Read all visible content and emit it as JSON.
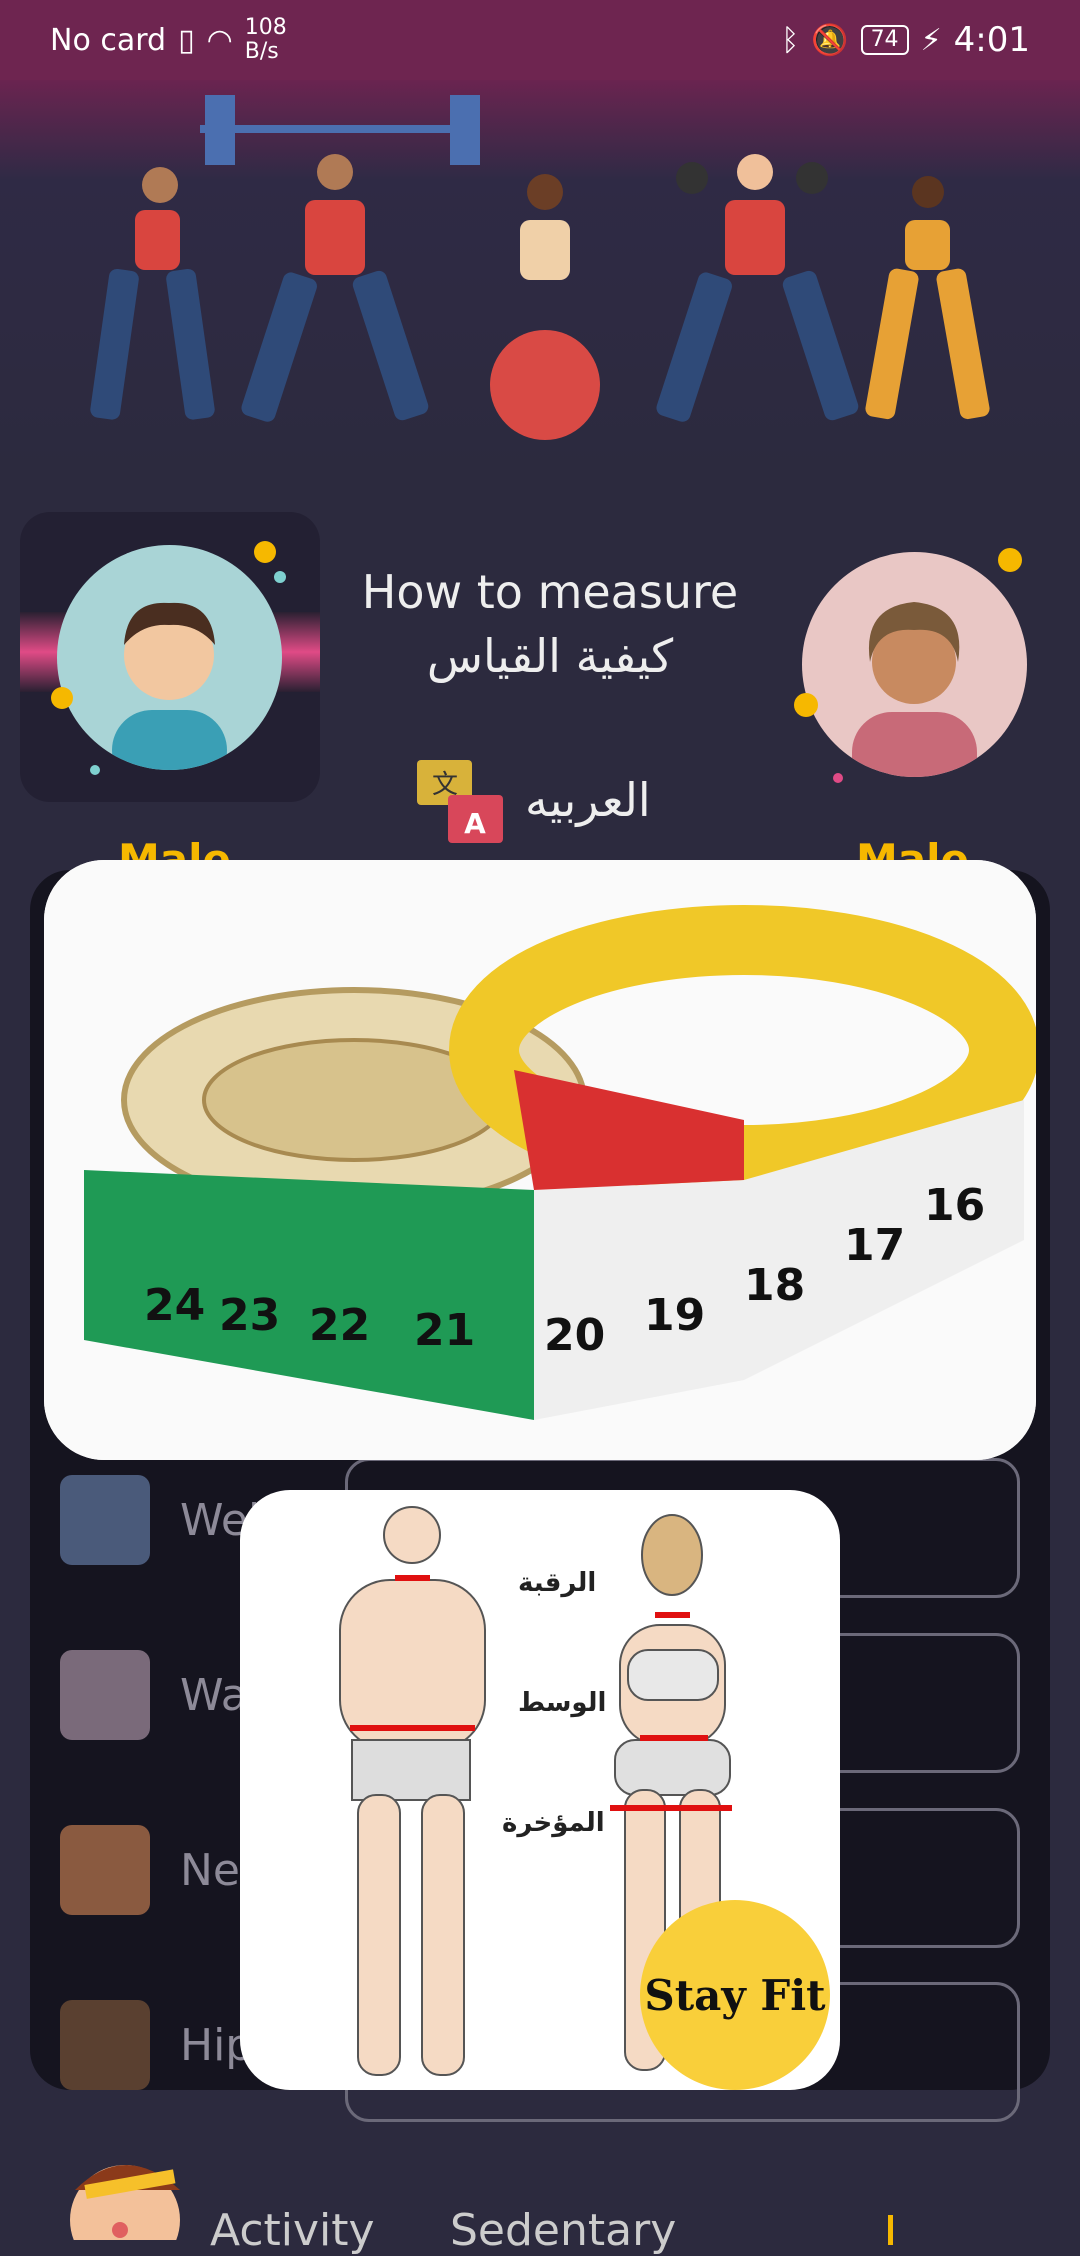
{
  "status_bar": {
    "carrier": "No card",
    "net_speed_value": "108",
    "net_speed_unit": "B/s",
    "battery": "74",
    "time": "4:01"
  },
  "header": {
    "title_en": "How to measure",
    "title_ar": "كيفية القياس",
    "language_label": "العربيه"
  },
  "gender": {
    "left_label": "Male",
    "right_label": "Male"
  },
  "inputs": [
    {
      "label": "Weight"
    },
    {
      "label": "Waist"
    },
    {
      "label": "Neck"
    },
    {
      "label": "Hips"
    }
  ],
  "body_diagram": {
    "neck_label": "الرقبة",
    "waist_label": "الوسط",
    "hips_label": "المؤخرة",
    "badge": "Stay Fit"
  },
  "bottom_tabs": {
    "activity": "Activity",
    "sedentary": "Sedentary"
  },
  "colors": {
    "accent": "#f6b800",
    "status_bar": "#6e2550",
    "background": "#2c2a3e"
  }
}
